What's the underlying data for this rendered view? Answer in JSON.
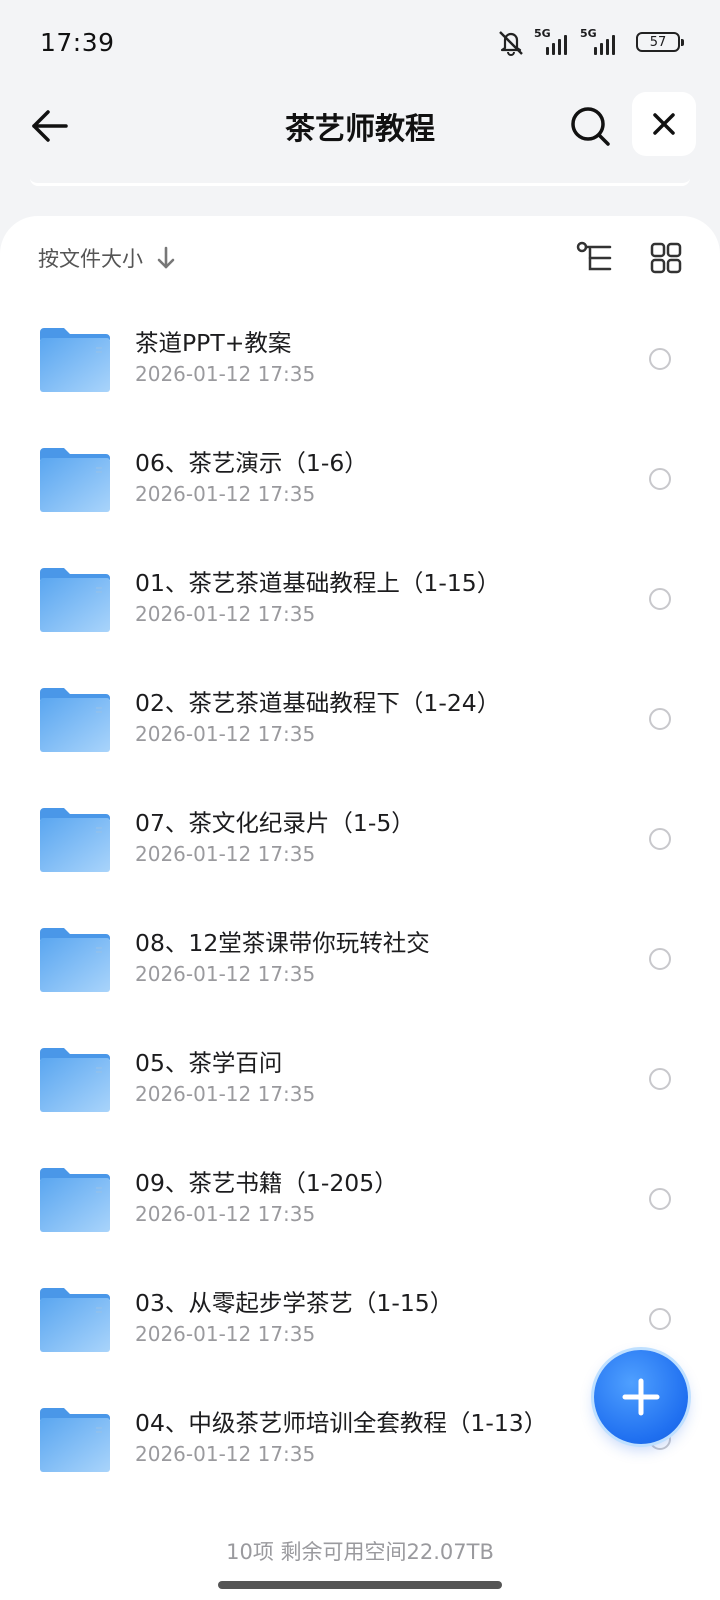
{
  "status": {
    "time": "17:39",
    "net_label_1": "5G",
    "net_label_2": "5G",
    "battery": "57"
  },
  "header": {
    "title": "茶艺师教程"
  },
  "sort": {
    "label": "按文件大小"
  },
  "files": [
    {
      "name": "茶道PPT+教案",
      "date": "2026-01-12 17:35"
    },
    {
      "name": "06、茶艺演示（1-6）",
      "date": "2026-01-12 17:35"
    },
    {
      "name": "01、茶艺茶道基础教程上（1-15）",
      "date": "2026-01-12 17:35"
    },
    {
      "name": "02、茶艺茶道基础教程下（1-24）",
      "date": "2026-01-12 17:35"
    },
    {
      "name": "07、茶文化纪录片（1-5）",
      "date": "2026-01-12 17:35"
    },
    {
      "name": "08、12堂茶课带你玩转社交",
      "date": "2026-01-12 17:35"
    },
    {
      "name": "05、茶学百问",
      "date": "2026-01-12 17:35"
    },
    {
      "name": "09、茶艺书籍（1-205）",
      "date": "2026-01-12 17:35"
    },
    {
      "name": "03、从零起步学茶艺（1-15）",
      "date": "2026-01-12 17:35"
    },
    {
      "name": "04、中级茶艺师培训全套教程（1-13）",
      "date": "2026-01-12 17:35"
    }
  ],
  "footer": {
    "text": "10项 剩余可用空间22.07TB"
  },
  "icons": {
    "back": "arrow-left-icon",
    "search": "search-icon",
    "close": "close-icon",
    "sort": "arrow-down-icon",
    "tree": "tree-view-icon",
    "grid": "grid-view-icon",
    "folder": "folder-icon",
    "add": "plus-icon",
    "mute": "bell-off-icon"
  },
  "colors": {
    "accent": "#1f6ff0",
    "folder": "#6fb3f5",
    "panel": "#ffffff",
    "background": "#f3f4f6"
  }
}
